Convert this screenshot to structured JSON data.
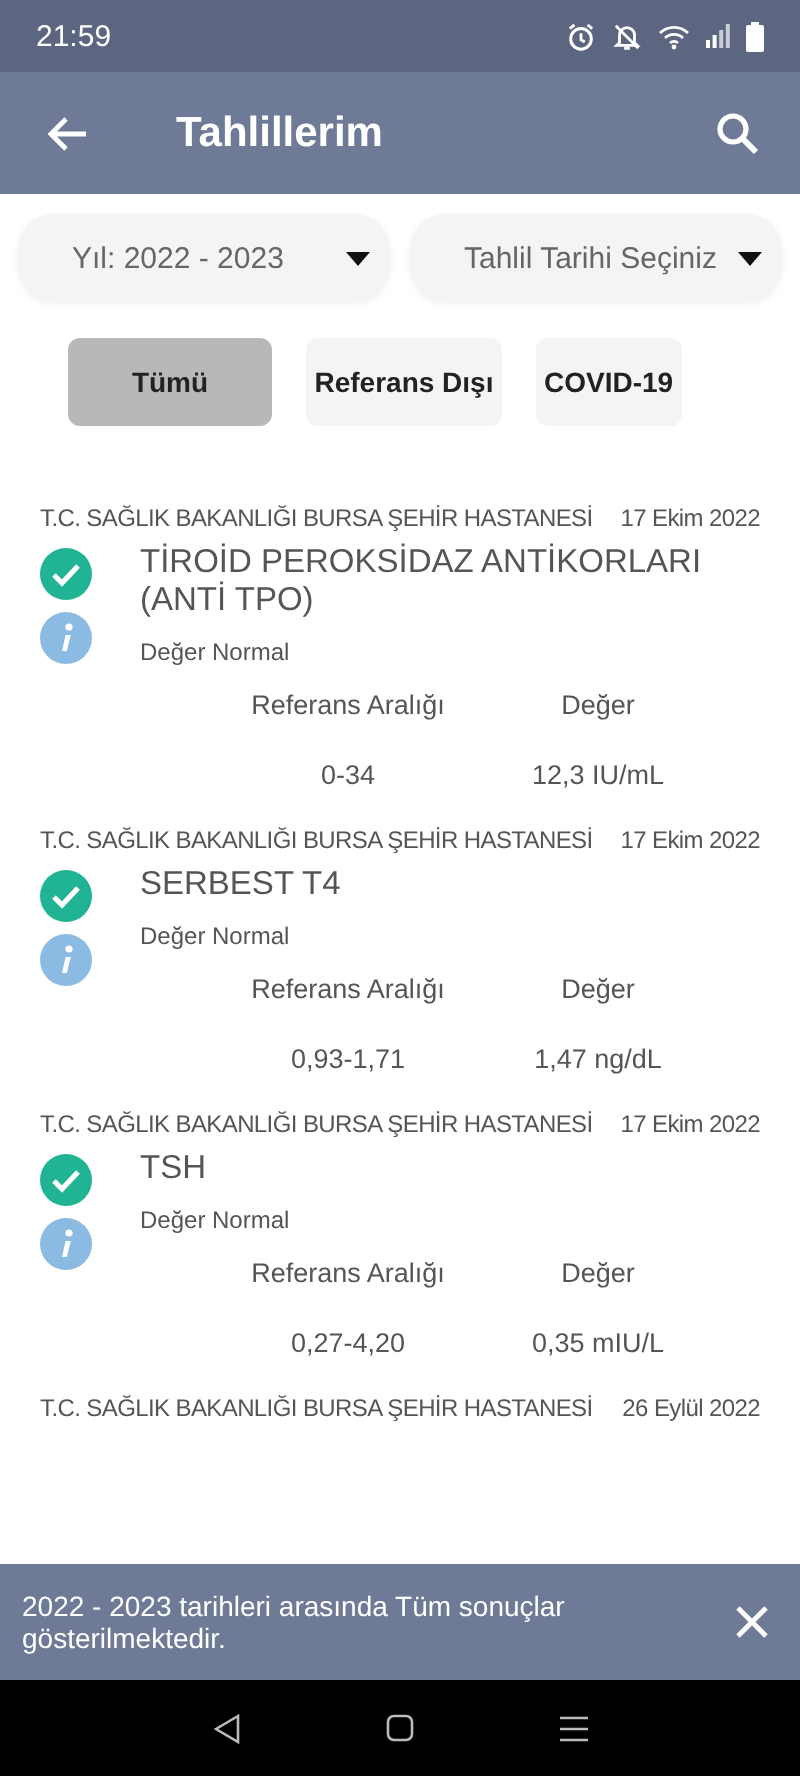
{
  "status_bar": {
    "time": "21:59"
  },
  "app_bar": {
    "title": "Tahlillerim"
  },
  "filters": [
    {
      "label": "Yıl: 2022 - 2023"
    },
    {
      "label": "Tahlil Tarihi Seçiniz"
    }
  ],
  "chips": [
    {
      "label": "Tümü",
      "selected": true
    },
    {
      "label": "Referans Dışı",
      "selected": false
    },
    {
      "label": "COVID-19",
      "selected": false
    }
  ],
  "results": [
    {
      "hospital": "T.C. SAĞLIK BAKANLIĞI BURSA ŞEHİR HASTANESİ",
      "date": "17 Ekim 2022",
      "test": "TİROİD PEROKSİDAZ ANTİKORLARI (ANTİ TPO)",
      "status": "Değer Normal",
      "normal": true,
      "range_label": "Referans Aralığı",
      "value_label": "Değer",
      "range": "0-34",
      "value": "12,3 IU/mL"
    },
    {
      "hospital": "T.C. SAĞLIK BAKANLIĞI BURSA ŞEHİR HASTANESİ",
      "date": "17 Ekim 2022",
      "test": "SERBEST T4",
      "status": "Değer Normal",
      "normal": true,
      "range_label": "Referans Aralığı",
      "value_label": "Değer",
      "range": "0,93-1,71",
      "value": "1,47 ng/dL"
    },
    {
      "hospital": "T.C. SAĞLIK BAKANLIĞI BURSA ŞEHİR HASTANESİ",
      "date": "17 Ekim 2022",
      "test": "TSH",
      "status": "Değer Normal",
      "normal": true,
      "range_label": "Referans Aralığı",
      "value_label": "Değer",
      "range": "0,27-4,20",
      "value": "0,35 mIU/L"
    },
    {
      "hospital": "T.C. SAĞLIK BAKANLIĞI BURSA ŞEHİR HASTANESİ",
      "date": "26 Eylül 2022"
    }
  ],
  "snackbar": {
    "message": "2022 - 2023 tarihleri arasında Tüm sonuçlar gösterilmektedir."
  }
}
